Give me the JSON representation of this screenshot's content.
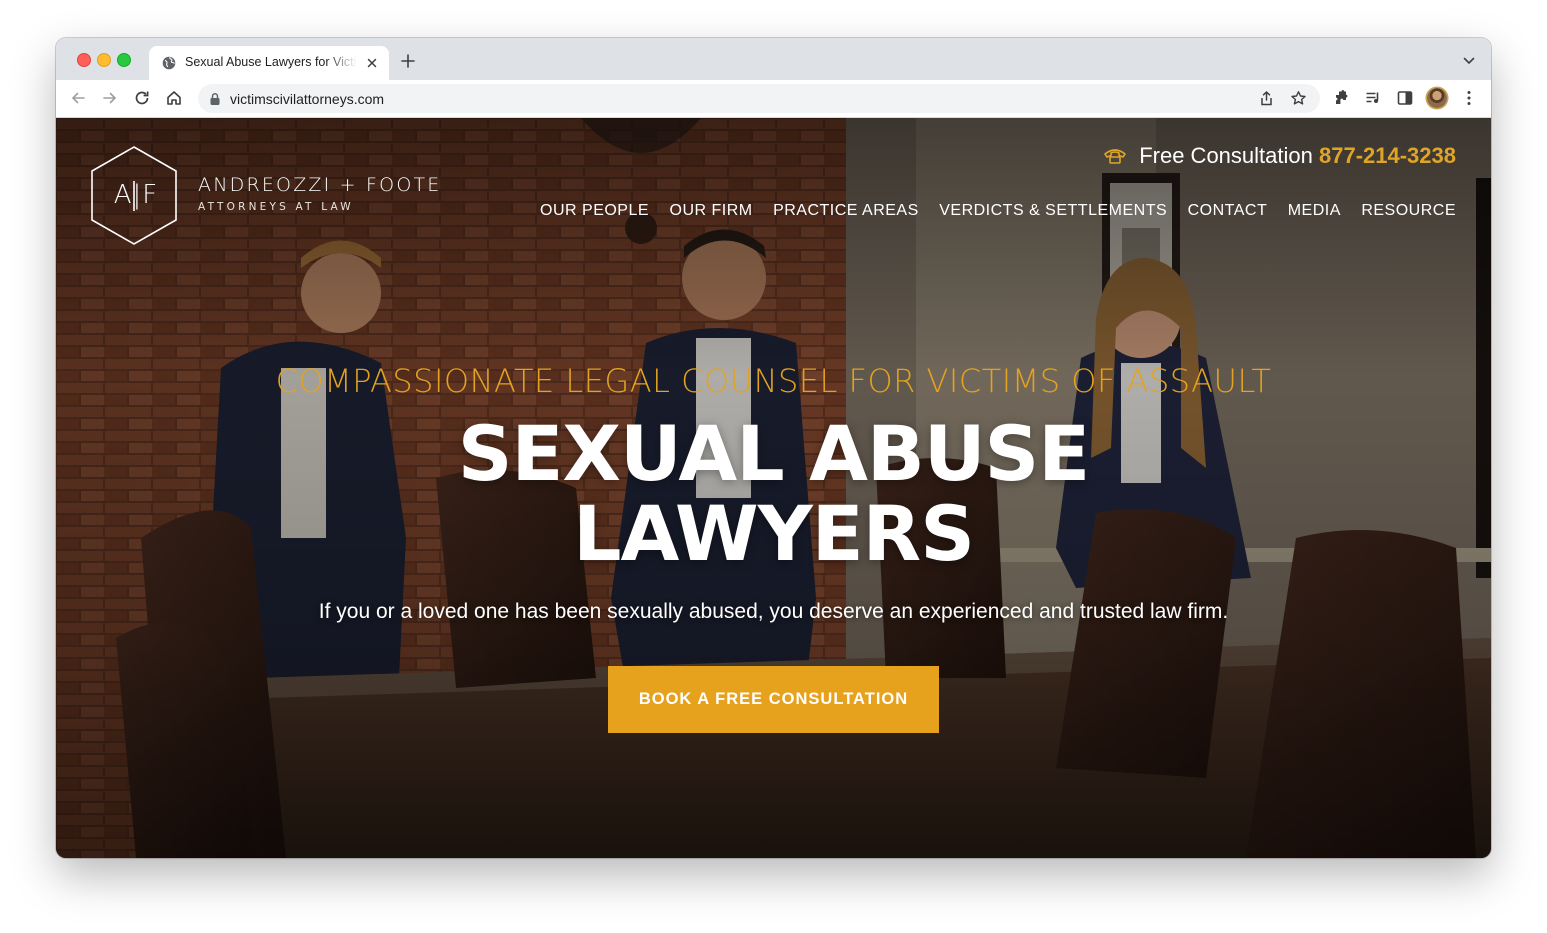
{
  "browser": {
    "tab_title": "Sexual Abuse Lawyers for Victims of Assault",
    "url": "victimscivilattorneys.com",
    "icons": [
      "globe-icon",
      "close-icon",
      "plus-icon",
      "chevron-down-icon",
      "back-icon",
      "forward-icon",
      "reload-icon",
      "home-icon",
      "lock-icon",
      "share-icon",
      "star-icon",
      "extensions-icon",
      "media-icon",
      "side-panel-icon",
      "kebab-menu-icon"
    ]
  },
  "site": {
    "logo_letters": "A|F",
    "firm_name": "ANDREOZZI + FOOTE",
    "firm_tagline": "ATTORNEYS AT LAW",
    "consult_label": "Free Consultation",
    "consult_phone": "877-214-3238",
    "nav": [
      "OUR PEOPLE",
      "OUR FIRM",
      "PRACTICE AREAS",
      "VERDICTS & SETTLEMENTS",
      "CONTACT",
      "MEDIA",
      "RESOURCE"
    ]
  },
  "hero": {
    "eyebrow": "COMPASSIONATE LEGAL COUNSEL FOR VICTIMS OF ASSAULT",
    "headline_line1": "SEXUAL ABUSE",
    "headline_line2": "LAWYERS",
    "subtext": "If you or a loved one has been sexually abused, you deserve an experienced and trusted law firm.",
    "cta_label": "BOOK A FREE CONSULTATION"
  },
  "colors": {
    "accent": "#e6a11d",
    "text_on_dark": "#ffffff"
  }
}
